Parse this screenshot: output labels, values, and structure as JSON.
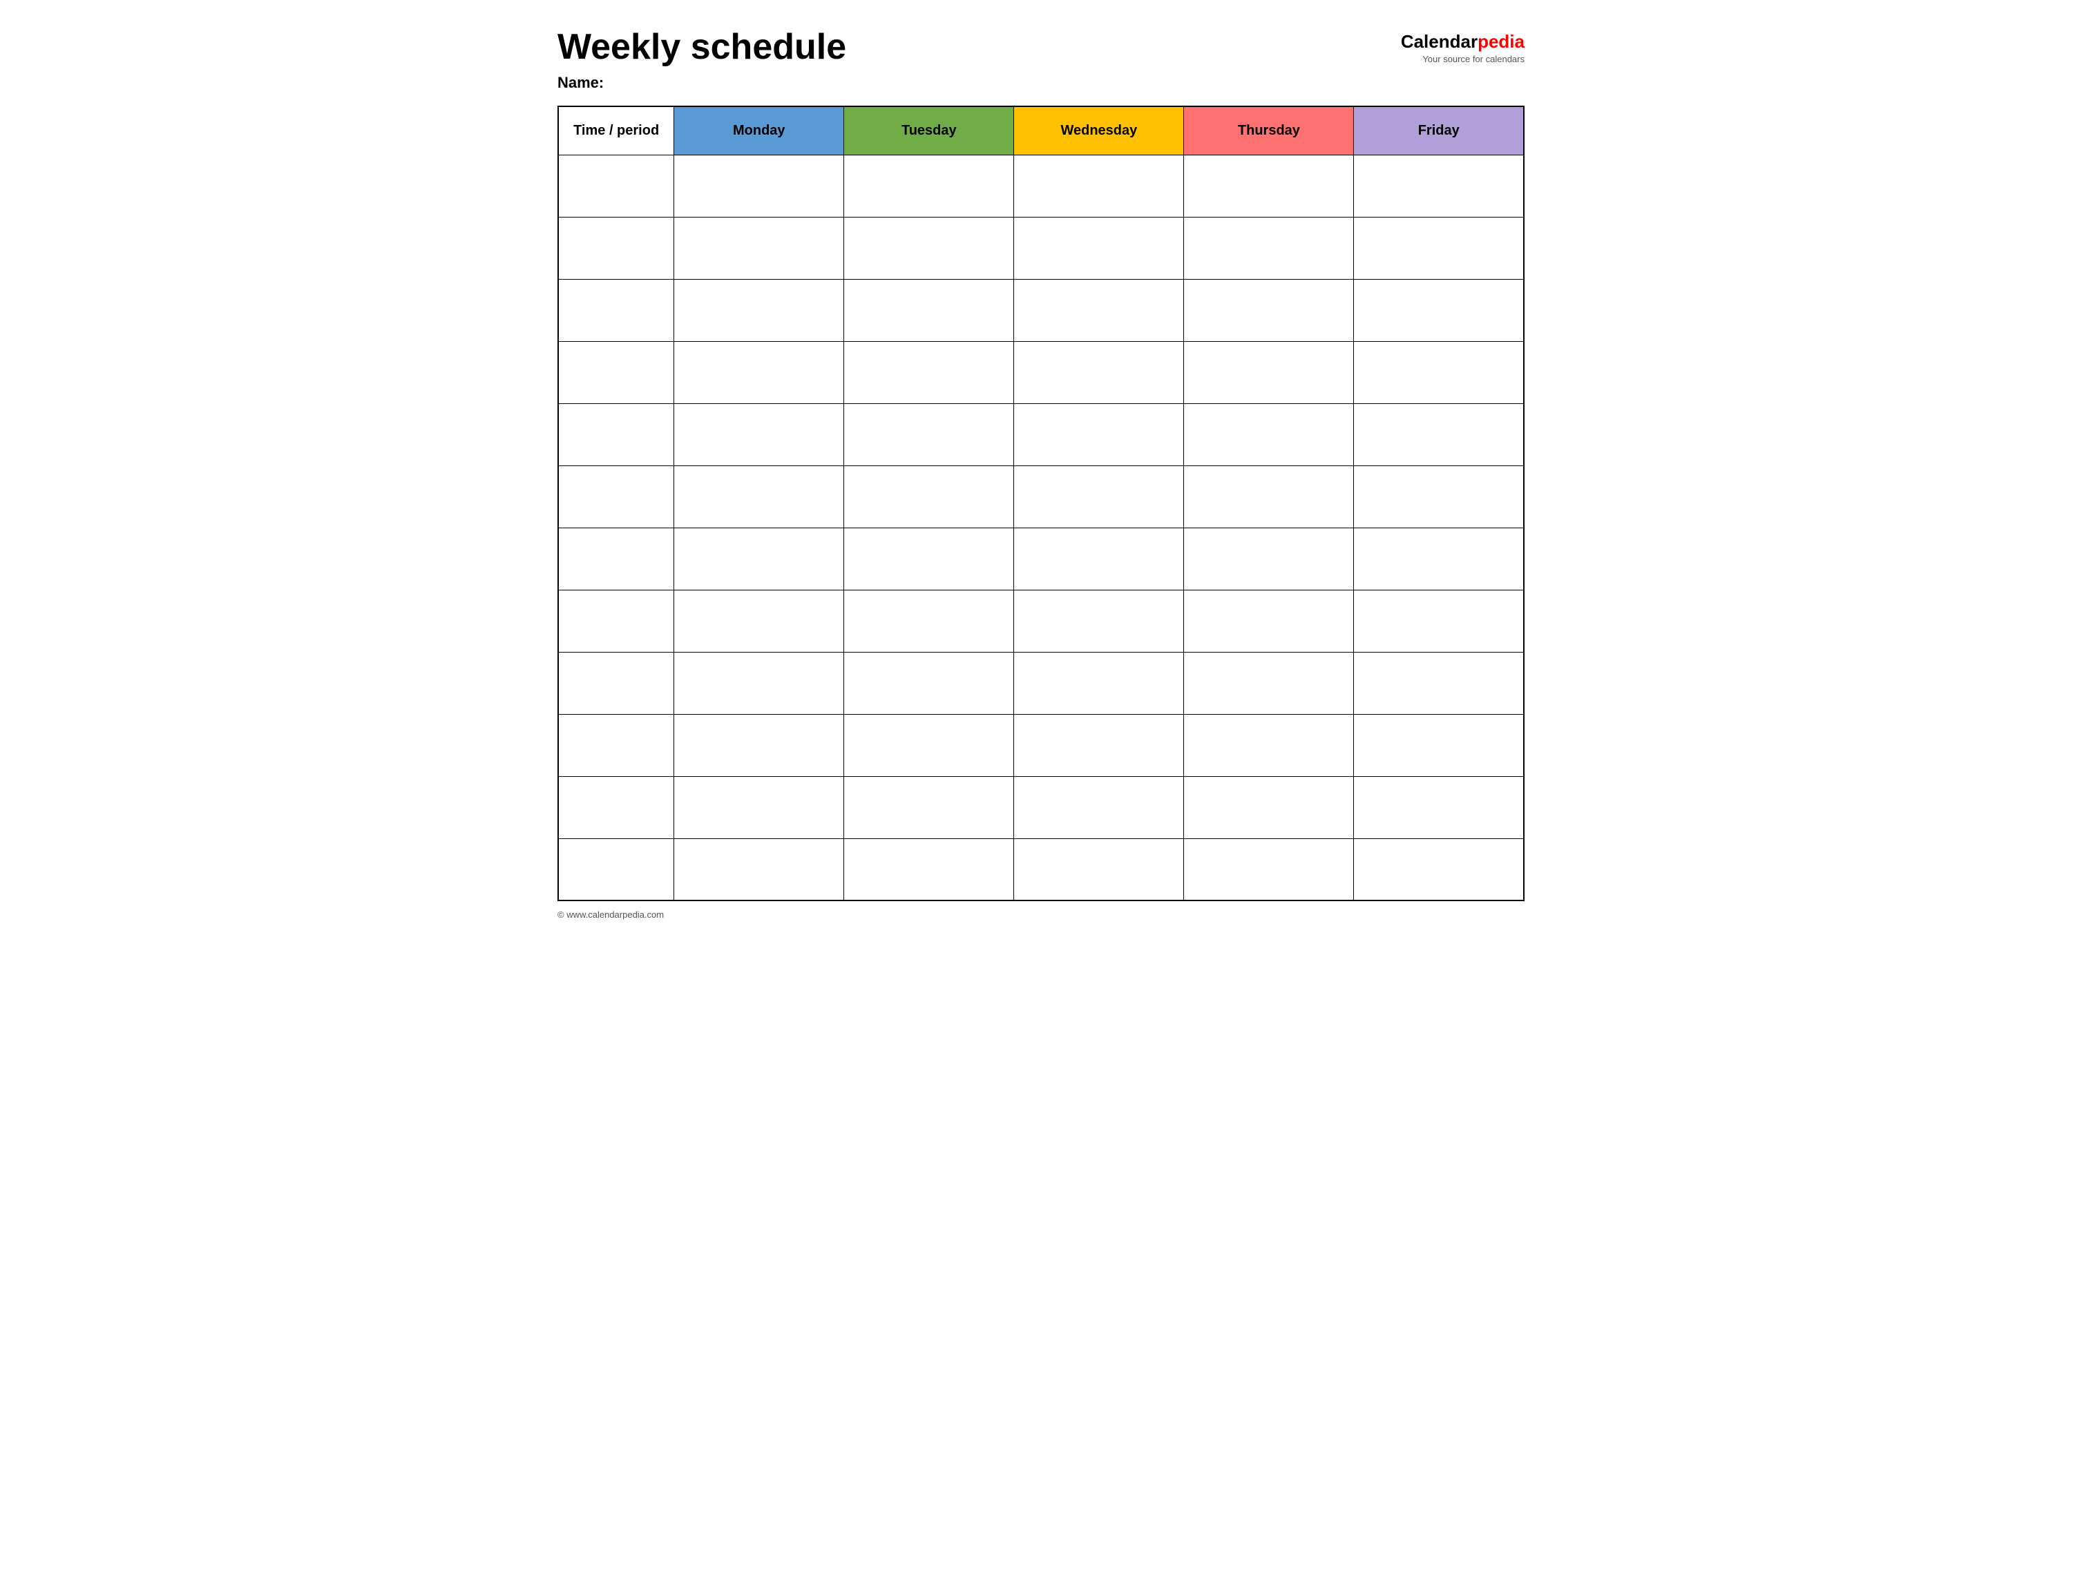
{
  "header": {
    "title": "Weekly schedule",
    "name_label": "Name:",
    "logo": {
      "calendar_part": "Calendar",
      "pedia_part": "pedia",
      "subtitle": "Your source for calendars"
    }
  },
  "table": {
    "columns": [
      {
        "id": "time",
        "label": "Time / period",
        "color": "#ffffff"
      },
      {
        "id": "monday",
        "label": "Monday",
        "color": "#5b9bd5"
      },
      {
        "id": "tuesday",
        "label": "Tuesday",
        "color": "#70ad47"
      },
      {
        "id": "wednesday",
        "label": "Wednesday",
        "color": "#ffc000"
      },
      {
        "id": "thursday",
        "label": "Thursday",
        "color": "#ff7070"
      },
      {
        "id": "friday",
        "label": "Friday",
        "color": "#b09fd8"
      }
    ],
    "row_count": 12
  },
  "footer": {
    "url": "© www.calendarpedia.com"
  }
}
